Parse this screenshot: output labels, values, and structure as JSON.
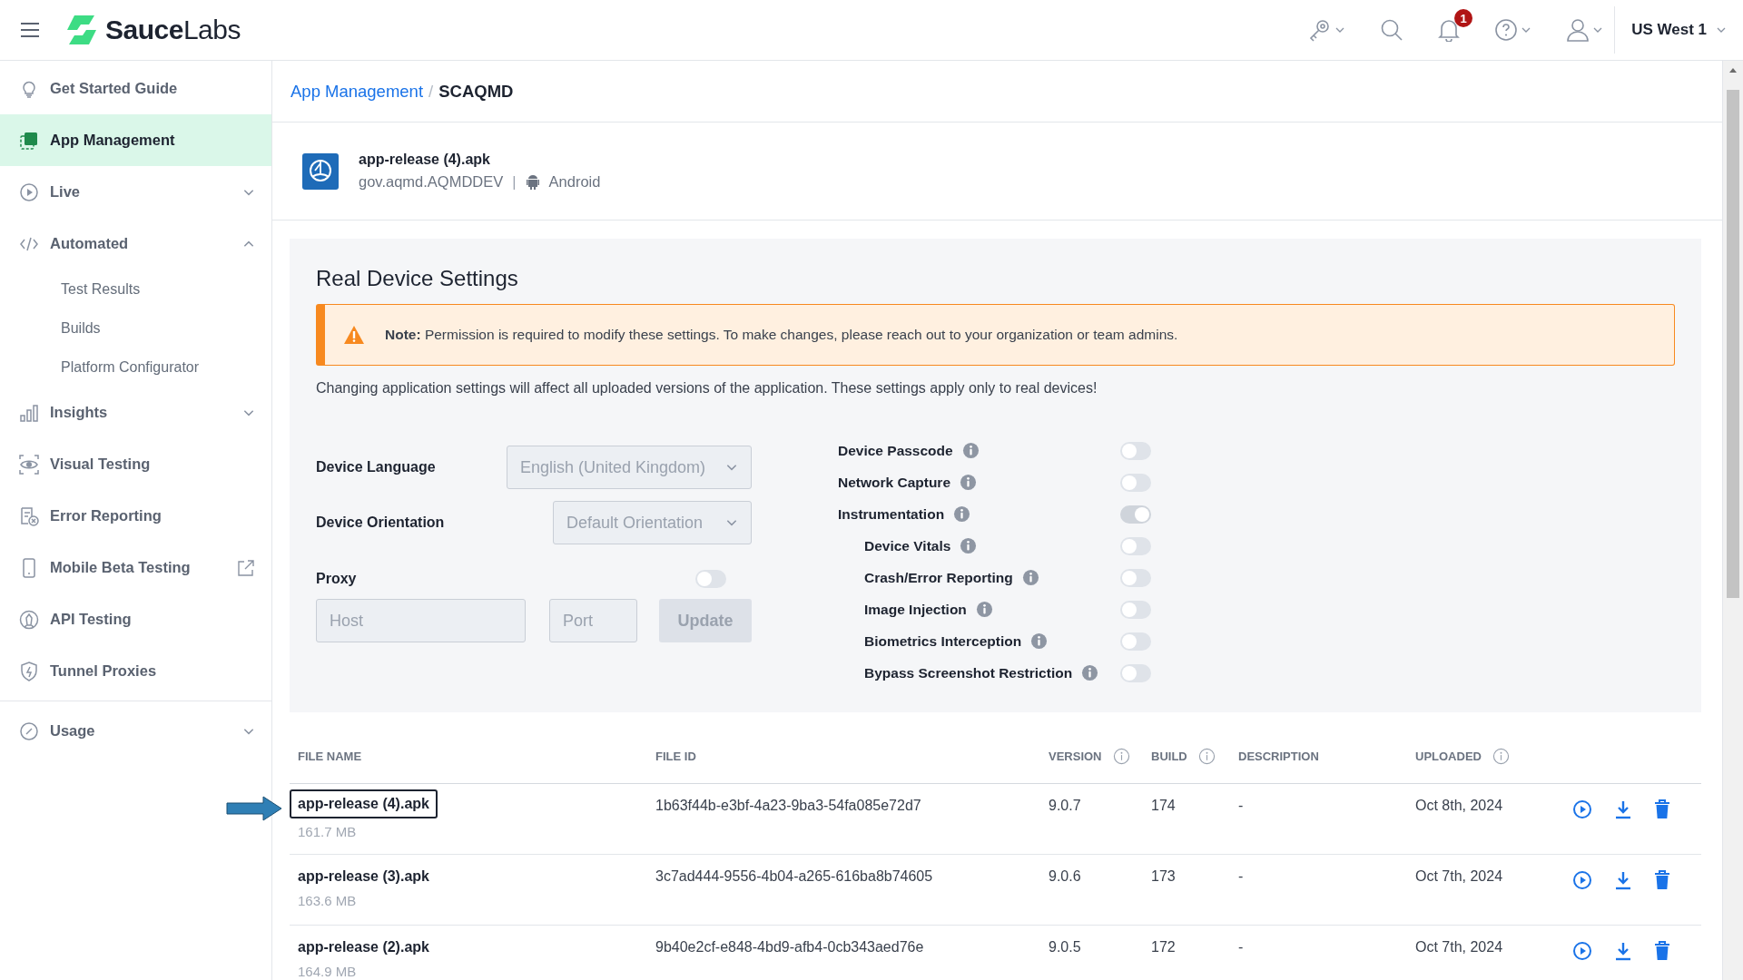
{
  "header": {
    "logo": "**Sauce**Labs",
    "notifications": "1",
    "region": "US West 1"
  },
  "sidebar": {
    "items": [
      {
        "label": "Get Started Guide",
        "kind": "link",
        "selected": false
      },
      {
        "label": "App Management",
        "kind": "link",
        "selected": true
      },
      {
        "label": "Live",
        "kind": "group",
        "expanded": false,
        "selected": false
      },
      {
        "label": "Automated",
        "kind": "group",
        "expanded": true,
        "selected": false,
        "children": [
          {
            "label": "Test Results",
            "selected": false
          },
          {
            "label": "Builds",
            "selected": false
          },
          {
            "label": "Platform Configurator",
            "selected": false
          }
        ]
      },
      {
        "label": "Insights",
        "kind": "group",
        "expanded": false,
        "selected": false
      },
      {
        "label": "Visual Testing",
        "kind": "link",
        "selected": false
      },
      {
        "label": "Error Reporting",
        "kind": "link",
        "selected": false
      },
      {
        "label": "Mobile Beta Testing",
        "kind": "external",
        "selected": false
      },
      {
        "label": "API Testing",
        "kind": "link",
        "selected": false
      },
      {
        "label": "Tunnel Proxies",
        "kind": "link",
        "selected": false
      }
    ],
    "bottom_items": [
      {
        "label": "Usage",
        "kind": "group",
        "expanded": false,
        "selected": false
      }
    ]
  },
  "breadcrumb": {
    "separator": "/",
    "items": [
      {
        "label": "App Management",
        "kind": "link"
      },
      {
        "label": "SCAQMD",
        "kind": "current"
      }
    ]
  },
  "app": {
    "name": "app-release (4).apk",
    "package": "gov.aqmd.AQMDDEV",
    "separator": "|",
    "platform": "Android"
  },
  "settings": {
    "title": "Real Device Settings",
    "note": "**Note:** Permission is required to modify these settings. To make changes, please reach out to your organization or team admins.",
    "description": "Changing application settings will affect all uploaded versions of the application. These settings apply only to real devices!",
    "fields": [
      {
        "label": "Device Language",
        "value": "English (United Kingdom)"
      },
      {
        "label": "Device Orientation",
        "value": "Default Orientation"
      }
    ],
    "proxy": {
      "label": "Proxy",
      "on": false,
      "host_placeholder": "Host",
      "port_placeholder": "Port",
      "button": "Update"
    },
    "toggles": [
      {
        "label": "Device Passcode",
        "on": false
      },
      {
        "label": "Network Capture",
        "on": false
      },
      {
        "label": "Instrumentation",
        "on": true,
        "children": [
          {
            "label": "Device Vitals",
            "on": false
          },
          {
            "label": "Crash/Error Reporting",
            "on": false
          },
          {
            "label": "Image Injection",
            "on": false
          },
          {
            "label": "Biometrics Interception",
            "on": false
          },
          {
            "label": "Bypass Screenshot Restriction",
            "on": false
          }
        ]
      }
    ]
  },
  "table": {
    "columns": [
      {
        "label": "FILE NAME",
        "info": false
      },
      {
        "label": "FILE ID",
        "info": false
      },
      {
        "label": "VERSION",
        "info": true
      },
      {
        "label": "BUILD",
        "info": true
      },
      {
        "label": "DESCRIPTION",
        "info": false
      },
      {
        "label": "UPLOADED",
        "info": true
      }
    ],
    "rows": [
      {
        "name": "app-release (4).apk",
        "size": "161.7 MB",
        "file_id": "1b63f44b-e3bf-4a23-9ba3-54fa085e72d7",
        "version": "9.0.7",
        "build": "174",
        "description": "-",
        "uploaded": "Oct 8th, 2024",
        "highlighted": true
      },
      {
        "name": "app-release (3).apk",
        "size": "163.6 MB",
        "file_id": "3c7ad444-9556-4b04-a265-616ba8b74605",
        "version": "9.0.6",
        "build": "173",
        "description": "-",
        "uploaded": "Oct 7th, 2024",
        "highlighted": false
      },
      {
        "name": "app-release (2).apk",
        "size": "164.9 MB",
        "file_id": "9b40e2cf-e848-4bd9-afb4-0cb343aed76e",
        "version": "9.0.5",
        "build": "172",
        "description": "-",
        "uploaded": "Oct 7th, 2024",
        "highlighted": false
      }
    ]
  }
}
